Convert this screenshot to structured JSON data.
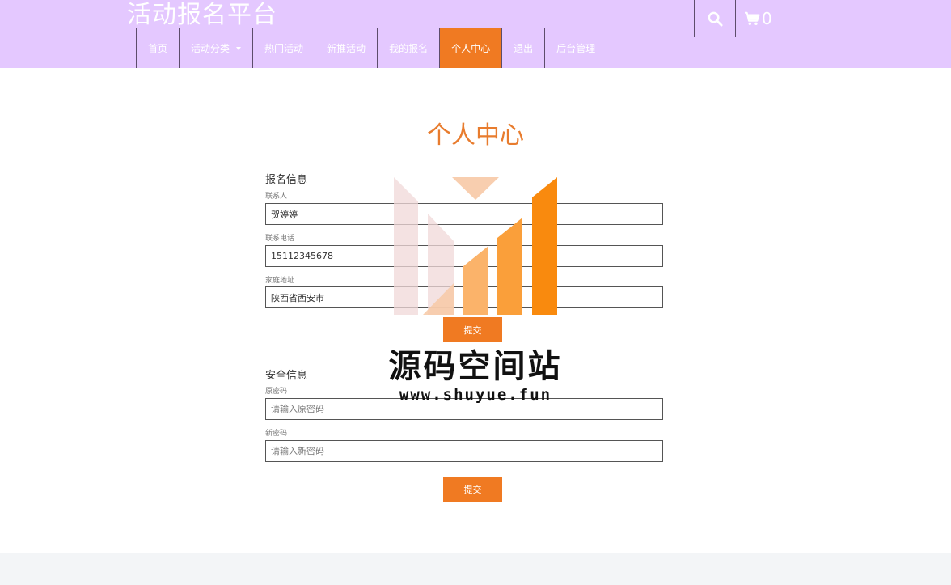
{
  "header": {
    "brand": "活动报名平台",
    "cart_count": "0"
  },
  "nav": {
    "items": [
      {
        "label": "首页"
      },
      {
        "label": "活动分类"
      },
      {
        "label": "热门活动"
      },
      {
        "label": "新推活动"
      },
      {
        "label": "我的报名"
      },
      {
        "label": "个人中心"
      },
      {
        "label": "退出"
      },
      {
        "label": "后台管理"
      }
    ],
    "active": "个人中心"
  },
  "page": {
    "title": "个人中心"
  },
  "signup_info": {
    "section_title": "报名信息",
    "contact_label": "联系人",
    "contact_value": "贺婷婷",
    "phone_label": "联系电话",
    "phone_value": "15112345678",
    "address_label": "家庭地址",
    "address_value": "陕西省西安市",
    "submit_label": "提交"
  },
  "security_info": {
    "section_title": "安全信息",
    "old_password_label": "原密码",
    "old_password_placeholder": "请输入原密码",
    "new_password_label": "新密码",
    "new_password_placeholder": "请输入新密码",
    "submit_label": "提交"
  },
  "watermark": {
    "text": "源码空间站",
    "url": "www.shuyue.fun"
  },
  "icons": {
    "search": "search-icon",
    "cart": "cart-icon",
    "dropdown": "chevron-down-icon"
  },
  "colors": {
    "header_bg": "#e4c8ff",
    "accent": "#f07a22",
    "title": "#e87c2e",
    "footer_bg": "#f3f5f7"
  }
}
